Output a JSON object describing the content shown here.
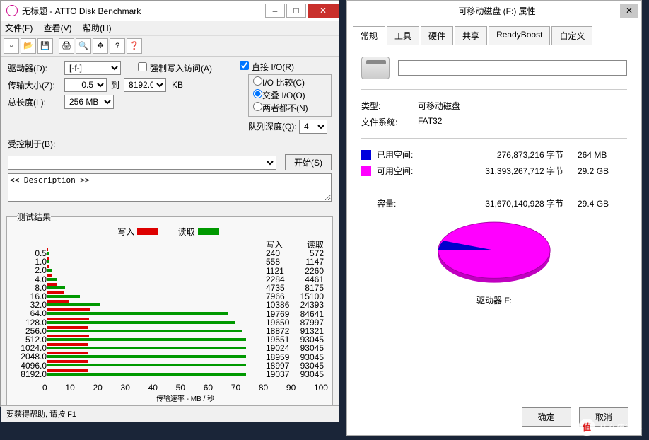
{
  "atto": {
    "title": "无标题 - ATTO Disk Benchmark",
    "menu": {
      "file": "文件(F)",
      "view": "查看(V)",
      "help": "帮助(H)"
    },
    "form": {
      "drive_label": "驱动器(D):",
      "drive_value": "[-f-]",
      "force_write": "强制写入访问(A)",
      "direct_io": "直接 I/O(R)",
      "xfer_label": "传输大小(Z):",
      "xfer_from": "0.5",
      "xfer_to_label": "到",
      "xfer_to": "8192.0",
      "xfer_unit": "KB",
      "len_label": "总长度(L):",
      "len_value": "256 MB",
      "radio_compare": "I/O 比较(C)",
      "radio_overlap": "交叠 I/O(O)",
      "radio_neither": "两者都不(N)",
      "qd_label": "队列深度(Q):",
      "qd_value": "4",
      "ctrl_label": "受控制于(B):",
      "start": "开始(S)",
      "desc": "<< Description >>"
    },
    "results": {
      "title": "测试结果",
      "write_label": "写入",
      "read_label": "读取",
      "xlabel": "传输速率 - MB / 秒",
      "xticks": [
        "0",
        "10",
        "20",
        "30",
        "40",
        "50",
        "60",
        "70",
        "80",
        "90",
        "100"
      ]
    },
    "status": "要获得帮助, 请按 F1"
  },
  "props": {
    "title": "可移动磁盘 (F:) 属性",
    "tabs": {
      "general": "常规",
      "tools": "工具",
      "hardware": "硬件",
      "share": "共享",
      "readyboost": "ReadyBoost",
      "custom": "自定义"
    },
    "type_label": "类型:",
    "type_value": "可移动磁盘",
    "fs_label": "文件系统:",
    "fs_value": "FAT32",
    "used_label": "已用空间:",
    "used_bytes": "276,873,216 字节",
    "used_h": "264 MB",
    "free_label": "可用空间:",
    "free_bytes": "31,393,267,712 字节",
    "free_h": "29.2 GB",
    "cap_label": "容量:",
    "cap_bytes": "31,670,140,928 字节",
    "cap_h": "29.4 GB",
    "drive_label": "驱动器 F:",
    "ok": "确定",
    "cancel": "取消"
  },
  "watermark": "什么值得买",
  "chart_data": {
    "type": "bar",
    "title": "测试结果",
    "xlabel": "传输速率 - MB / 秒",
    "xlim": [
      0,
      100
    ],
    "y_categories": [
      "0.5",
      "1.0",
      "2.0",
      "4.0",
      "8.0",
      "16.0",
      "32.0",
      "64.0",
      "128.0",
      "256.0",
      "512.0",
      "1024.0",
      "2048.0",
      "4096.0",
      "8192.0"
    ],
    "series": [
      {
        "name": "写入",
        "color": "#d00000",
        "values_kb_s": [
          240,
          558,
          1121,
          2284,
          4735,
          7966,
          10386,
          19769,
          19650,
          18872,
          19551,
          19024,
          18959,
          18997,
          19037
        ]
      },
      {
        "name": "读取",
        "color": "#009000",
        "values_kb_s": [
          572,
          1147,
          2260,
          4461,
          8175,
          15100,
          24393,
          84641,
          87997,
          91321,
          93045,
          93045,
          93045,
          93045,
          93045
        ]
      }
    ]
  }
}
